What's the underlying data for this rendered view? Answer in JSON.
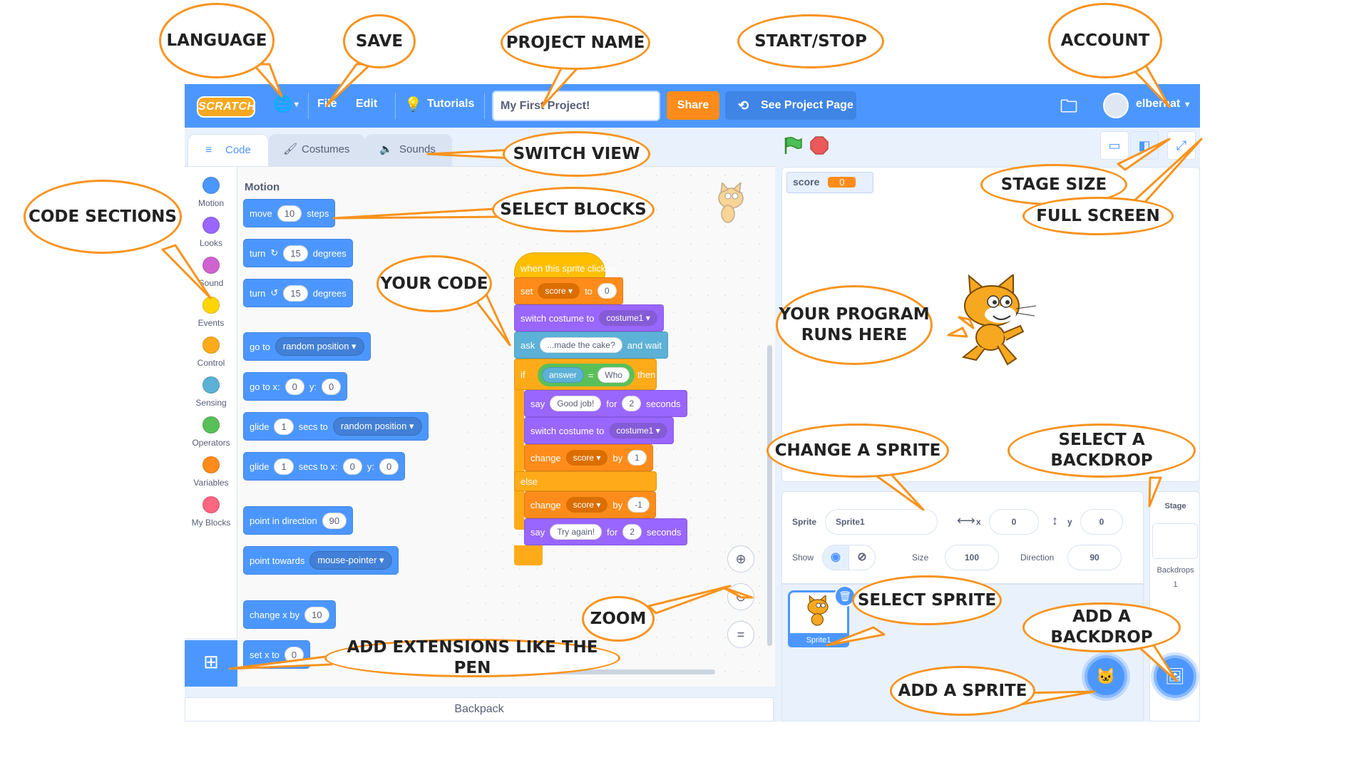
{
  "menubar": {
    "logo": "SCRATCH",
    "file": "File",
    "edit": "Edit",
    "tutorials": "Tutorials",
    "project_name": "My First Project!",
    "share": "Share",
    "see_project_page": "See Project Page",
    "username": "elbernat"
  },
  "tabs": {
    "code": "Code",
    "costumes": "Costumes",
    "sounds": "Sounds"
  },
  "categories": [
    {
      "label": "Motion",
      "color": "#4c97ff"
    },
    {
      "label": "Looks",
      "color": "#9966ff"
    },
    {
      "label": "Sound",
      "color": "#cf63cf"
    },
    {
      "label": "Events",
      "color": "#ffd500"
    },
    {
      "label": "Control",
      "color": "#ffab19"
    },
    {
      "label": "Sensing",
      "color": "#5cb1d6"
    },
    {
      "label": "Operators",
      "color": "#59c059"
    },
    {
      "label": "Variables",
      "color": "#ff8c1a"
    },
    {
      "label": "My Blocks",
      "color": "#ff6680"
    }
  ],
  "palette": {
    "title": "Motion",
    "move": "move",
    "move_val": "10",
    "steps": "steps",
    "turn": "turn",
    "turn_right_val": "15",
    "turn_left_val": "15",
    "degrees": "degrees",
    "goto": "go to",
    "goto_target": "random position",
    "gotoxy": "go to x:",
    "gotoxy_x": "0",
    "gotoxy_y": "0",
    "y_label": "y:",
    "glide": "glide",
    "glide1_secs": "1",
    "secs_to": "secs to",
    "glide1_target": "random position",
    "glide2_secs": "1",
    "secs_to_x": "secs to x:",
    "glide2_x": "0",
    "glide2_y": "0",
    "point_dir": "point in direction",
    "point_dir_val": "90",
    "point_towards": "point towards",
    "point_towards_target": "mouse-pointer",
    "change_x": "change x by",
    "change_x_val": "10",
    "set_x": "set x to",
    "set_x_val": "0"
  },
  "script": {
    "hat": "when this sprite clicked",
    "set": "set",
    "set_var": "score",
    "to": "to",
    "set_val": "0",
    "switch_costume": "switch costume to",
    "costume": "costume1",
    "ask": "ask",
    "ask_text": "...made the cake?",
    "and_wait": "and wait",
    "if": "if",
    "answer": "answer",
    "equals": "=",
    "who": "Who",
    "then": "then",
    "say": "say",
    "good_job": "Good job!",
    "for": "for",
    "say1_secs": "2",
    "seconds": "seconds",
    "switch_costume2": "switch costume to",
    "costume2": "costume1",
    "change": "change",
    "change_var": "score",
    "by": "by",
    "change1_val": "1",
    "else": "else",
    "change2_val": "-1",
    "try_again": "Try again!",
    "say2_secs": "2"
  },
  "stage": {
    "monitor_label": "score",
    "monitor_value": "0"
  },
  "sprite_info": {
    "sprite_label": "Sprite",
    "sprite_name": "Sprite1",
    "x_label": "x",
    "x_val": "0",
    "y_label": "y",
    "y_val": "0",
    "show_label": "Show",
    "size_label": "Size",
    "size_val": "100",
    "direction_label": "Direction",
    "direction_val": "90"
  },
  "sprite_list": {
    "sprite1": "Sprite1"
  },
  "stage_pane": {
    "title": "Stage",
    "backdrops_label": "Backdrops",
    "backdrops_count": "1"
  },
  "backpack": "Backpack",
  "annotations": {
    "language": "LANGUAGE",
    "save": "SAVE",
    "project_name": "PROJECT NAME",
    "start_stop": "START/STOP",
    "account": "ACCOUNT",
    "switch_view": "SWITCH VIEW",
    "stage_size": "STAGE SIZE",
    "full_screen": "FULL SCREEN",
    "code_sections": "CODE SECTIONS",
    "select_blocks": "SELECT BLOCKS",
    "your_code": "YOUR CODE",
    "program_runs_1": "YOUR PROGRAM",
    "program_runs_2": "RUNS HERE",
    "change_sprite": "CHANGE A SPRITE",
    "select_backdrop": "SELECT A BACKDROP",
    "select_sprite": "SELECT SPRITE",
    "add_backdrop": "ADD A BACKDROP",
    "zoom": "ZOOM",
    "add_sprite": "ADD A SPRITE",
    "add_extensions": "ADD EXTENSIONS LIKE THE PEN"
  },
  "colors": {
    "scratch_blue": "#4c97ff",
    "callout_orange": "#f7931e",
    "share_orange": "#ff8c1a"
  }
}
